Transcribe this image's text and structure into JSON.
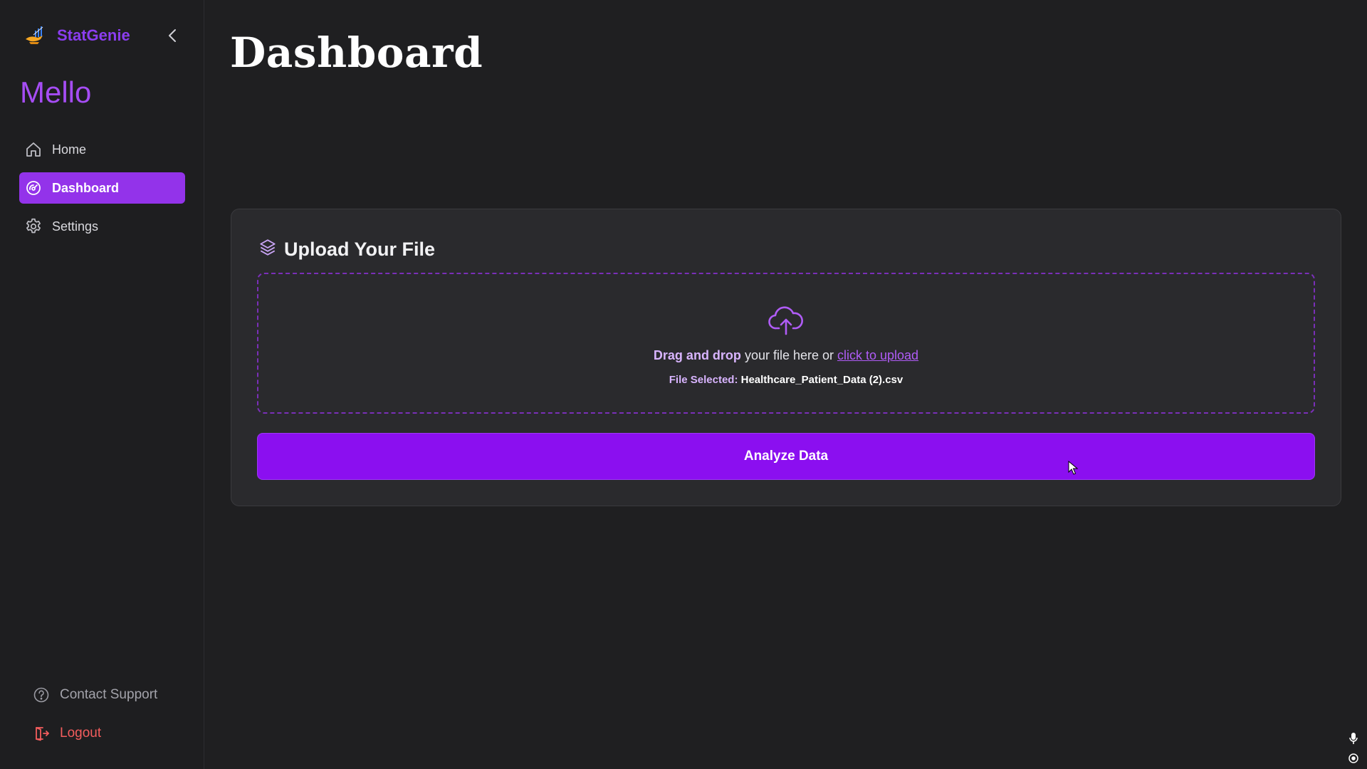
{
  "brand": {
    "name": "StatGenie",
    "logo_icon": "genie-lamp-logo",
    "collapse_icon": "chevron-left-icon"
  },
  "user": {
    "name": "Mello"
  },
  "sidebar": {
    "items": [
      {
        "label": "Home",
        "icon": "home-icon",
        "active": false
      },
      {
        "label": "Dashboard",
        "icon": "gauge-icon",
        "active": true
      },
      {
        "label": "Settings",
        "icon": "gear-icon",
        "active": false
      }
    ],
    "bottom_items": [
      {
        "label": "Contact Support",
        "icon": "help-circle-icon"
      },
      {
        "label": "Logout",
        "icon": "logout-icon"
      }
    ]
  },
  "main": {
    "title": "Dashboard",
    "upload_card": {
      "title": "Upload Your File",
      "icon": "layers-icon",
      "dropzone": {
        "icon": "cloud-upload-icon",
        "text_strong": "Drag and drop",
        "text_middle": " your file here or ",
        "link_text": "click to upload",
        "file_label": "File Selected: ",
        "file_name": "Healthcare_Patient_Data (2).csv"
      },
      "analyze_label": "Analyze Data"
    }
  },
  "colors": {
    "accent": "#9333ea",
    "button": "#8b0ff0",
    "brand_text": "#8b3df0",
    "logout": "#f35d5d",
    "background": "#1f1f21",
    "card": "#2a2a2d"
  }
}
